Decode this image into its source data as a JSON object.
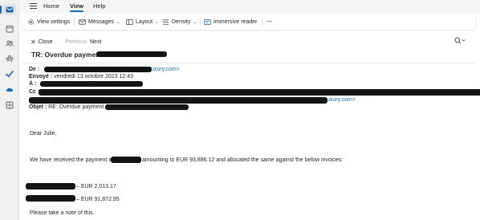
{
  "rail": {
    "items": [
      {
        "name": "mail-icon",
        "active": true
      },
      {
        "name": "calendar-icon"
      },
      {
        "name": "people-icon"
      },
      {
        "name": "groups-icon"
      },
      {
        "name": "todo-icon"
      },
      {
        "name": "onedrive-icon"
      },
      {
        "name": "apps-icon"
      }
    ]
  },
  "menu": {
    "tabs": [
      "Home",
      "View",
      "Help"
    ],
    "selected": "View"
  },
  "ribbon": {
    "view_settings": "View settings",
    "messages": "Messages",
    "layout": "Layout",
    "density": "Density",
    "immersive_reader": "Immersive reader",
    "more": "···"
  },
  "nav": {
    "close": "Close",
    "previous": "Previous",
    "next": "Next",
    "zoom_icon": "zoom-icon"
  },
  "email": {
    "subject": "TR: Overdue payment",
    "from_label": "De :",
    "from_suffix": "uxury.com>",
    "sent_label": "Envoyé :",
    "sent_value": " vendredi 13 octobre 2023 12:43",
    "to_label": "À :",
    "cc_label": "Cc :",
    "cc_suffix": "uxury.com>",
    "object_label": "Objet :",
    "object_value": " RE: Overdue payment <",
    "greeting": "Dear Julie,",
    "line1_prefix": "We have received the payment in",
    "line1_suffix": "amounting to EUR 93,886.12 and allocated the same against the below invoices:",
    "invoice1": "– EUR 2,013.17",
    "invoice2": "– EUR 91,872.95",
    "closing": "Please take a note of this."
  },
  "colors": {
    "accent": "#0f6cbd",
    "rail_bg": "#f0f0f0",
    "redaction": "#141414"
  }
}
